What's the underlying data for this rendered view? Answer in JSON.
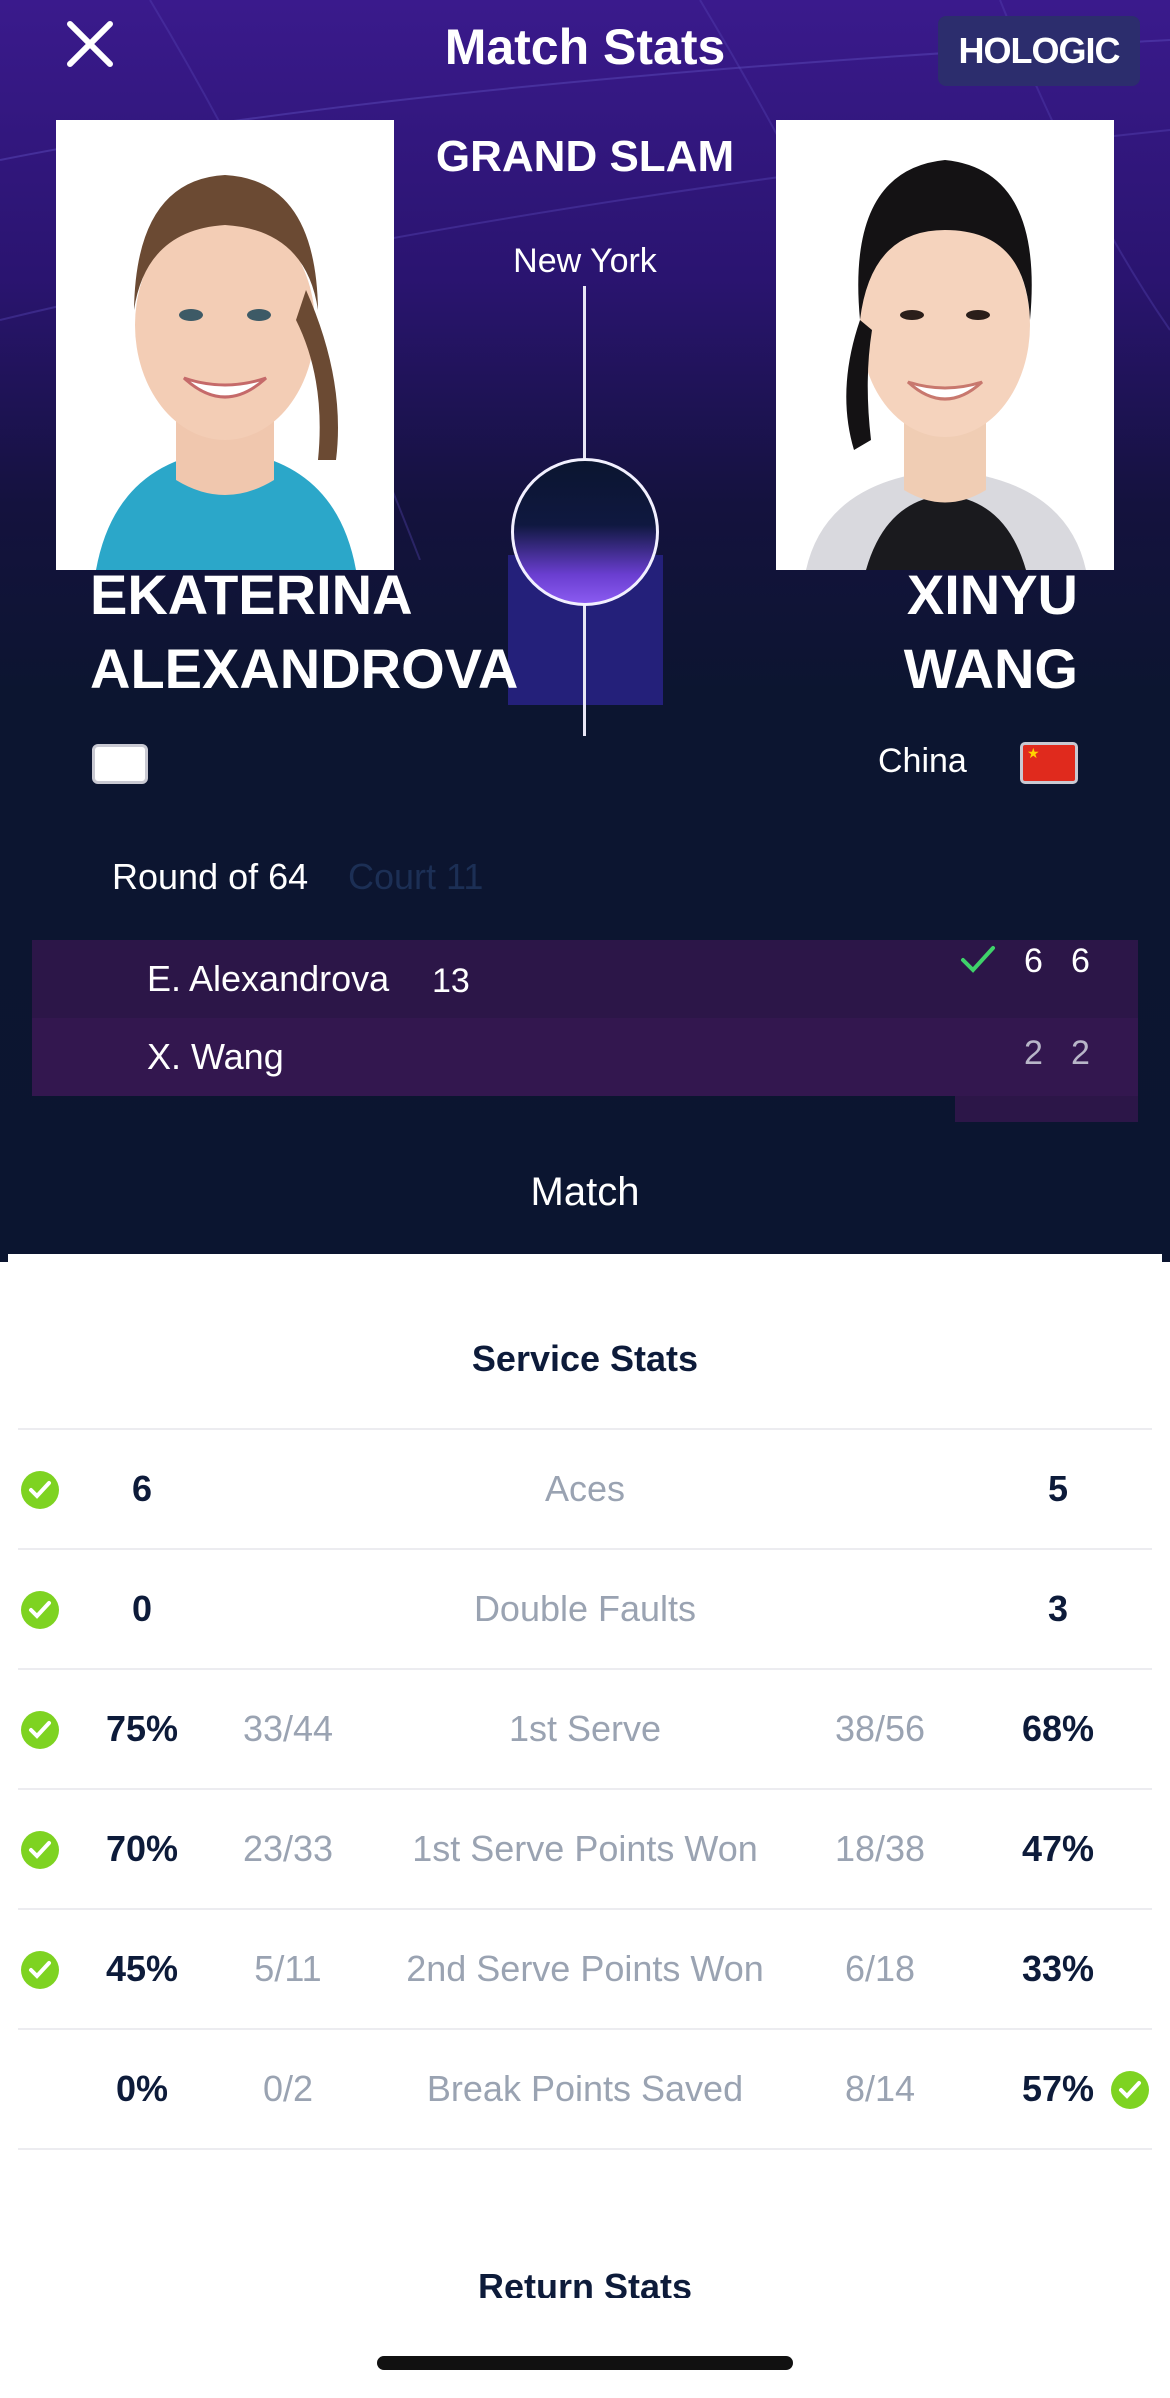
{
  "header": {
    "title": "Match Stats",
    "sponsor": "HOLOGIC",
    "event": "GRAND SLAM",
    "city": "New York"
  },
  "players": {
    "left": {
      "first": "EKATERINA",
      "last": "ALEXANDROVA",
      "short": "E. Alexandrova",
      "seed": "13"
    },
    "right": {
      "first": "XINYU",
      "last": "WANG",
      "short": "X. Wang",
      "country": "China"
    }
  },
  "match": {
    "round": "Round of 64",
    "court": "Court 11",
    "sets_left": [
      "6",
      "6"
    ],
    "sets_right": [
      "2",
      "2"
    ]
  },
  "tabs": {
    "active": "Match"
  },
  "service_stats": {
    "title": "Service Stats",
    "rows": [
      {
        "label": "Aces",
        "left": "6",
        "right": "5",
        "winner": "left"
      },
      {
        "label": "Double Faults",
        "left": "0",
        "right": "3",
        "winner": "left"
      },
      {
        "label": "1st Serve",
        "left": "75%",
        "left_frac": "33/44",
        "right_frac": "38/56",
        "right": "68%",
        "winner": "left"
      },
      {
        "label": "1st Serve Points Won",
        "left": "70%",
        "left_frac": "23/33",
        "right_frac": "18/38",
        "right": "47%",
        "winner": "left"
      },
      {
        "label": "2nd Serve Points Won",
        "left": "45%",
        "left_frac": "5/11",
        "right_frac": "6/18",
        "right": "33%",
        "winner": "left"
      },
      {
        "label": "Break Points Saved",
        "left": "0%",
        "left_frac": "0/2",
        "right_frac": "8/14",
        "right": "57%",
        "winner": "right"
      }
    ]
  },
  "return_stats": {
    "title": "Return Stats"
  },
  "colors": {
    "accent_green": "#7ed321",
    "header_dark": "#0b1530",
    "score_row": "#2c1648"
  },
  "icons": {
    "close": "close-icon",
    "winner": "check-circle-icon",
    "set_winner": "checkmark-icon"
  }
}
